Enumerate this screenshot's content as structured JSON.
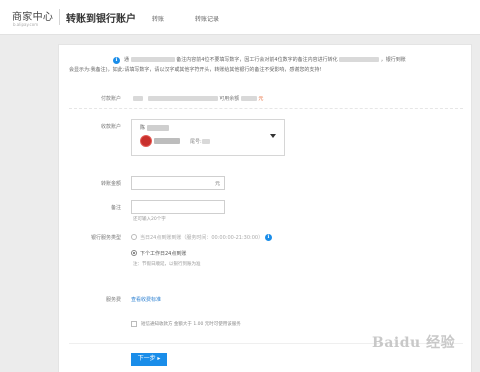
{
  "header": {
    "logo": "商家中心",
    "logo_sub": "b.alipay.com",
    "title": "转账到银行账户",
    "tabs": [
      {
        "label": "转账"
      },
      {
        "label": "转账记录"
      }
    ]
  },
  "notice": {
    "line1_a": "通",
    "line1_b": "备注内容前4位不要填写数字，因工行会对前4位数字的备注内容进行转化",
    "line1_c": "，银行到账",
    "line2": "会显示为:我备注)，如此:请填写数字，请以汉字或其他字符开头，转账给其他银行的备注不受影响，感谢您的支持!"
  },
  "form": {
    "payer_label": "付款账户",
    "payer_value_suffix": "可用余额",
    "payer_unit": "元",
    "receiver_label": "收款账户",
    "receiver_tail": "尾号:",
    "amount_label": "转账金额",
    "amount_unit": "元",
    "memo_label": "备注",
    "memo_hint": "还可输入20个字",
    "arrival_label": "银行服务类型",
    "option1": "当日24点到账到账（服务时间：00:00:00-21:30:00）",
    "option2": "下个工作日24点到账",
    "option_note": "注：节假日顺延，以银行到账为准",
    "fee_label": "服务费",
    "fee_link": "查看收费标准",
    "checkbox_label": "短信通知收款方  金额大于 1.00 元时可使用该服务",
    "next_button": "下一步 ▸"
  },
  "watermark": "Baidu 经验",
  "colors": {
    "accent": "#1a8de9",
    "link": "#2a7fd1",
    "bank": "#c9302c"
  }
}
